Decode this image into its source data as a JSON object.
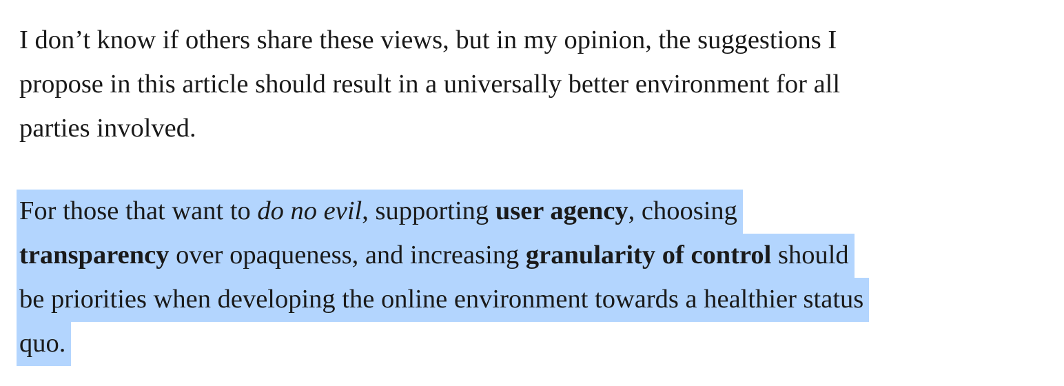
{
  "paragraph_1": {
    "lines": [
      "I don’t know if others share these views, but in my opinion, the suggestions I",
      "propose in this article should result in a universally better environment for all",
      "parties involved."
    ]
  },
  "paragraph_2": {
    "line_1": {
      "t1": "For those that want to ",
      "em1": "do no evil",
      "t2": ", supporting ",
      "strong1": "user agency",
      "t3": ", choosing"
    },
    "line_2": {
      "strong1": "transparency",
      "t1": " over opaqueness, and increasing ",
      "strong2": "granularity of control",
      "t2": " should"
    },
    "line_3": {
      "t1": "be priorities when developing the online environment towards a healthier status"
    },
    "line_4": {
      "t1": "quo."
    },
    "selection_color": "#b3d5fe"
  }
}
